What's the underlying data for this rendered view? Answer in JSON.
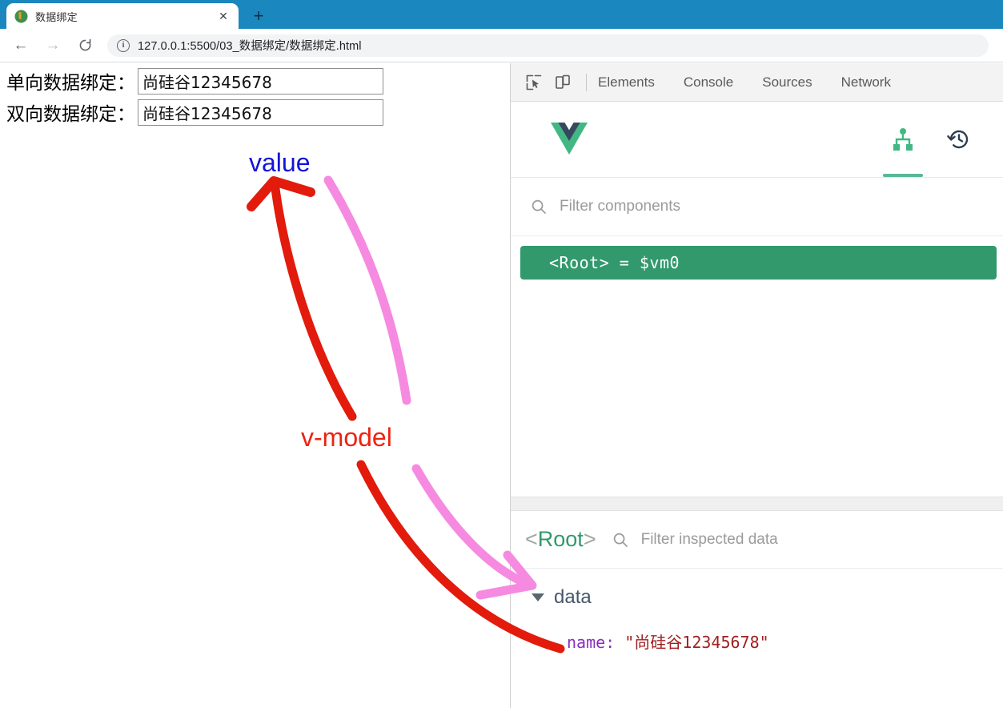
{
  "browser": {
    "tab": {
      "title": "数据绑定",
      "favicon_icon": "vue-circle-favicon",
      "close_icon": "close-icon",
      "close_label": "✕"
    },
    "new_tab_label": "+",
    "new_tab_icon": "plus-icon",
    "nav": {
      "back_icon": "arrow-left-icon",
      "back_label": "←",
      "forward_icon": "arrow-right-icon",
      "forward_label": "→",
      "reload_icon": "reload-icon",
      "reload_label": "⟳"
    },
    "omnibox": {
      "info_icon": "info-circle-icon",
      "info_label": "i",
      "url": "127.0.0.1:5500/03_数据绑定/数据绑定.html"
    }
  },
  "page": {
    "rows": [
      {
        "label": "单向数据绑定：",
        "value": "尚硅谷12345678"
      },
      {
        "label": "双向数据绑定：",
        "value": "尚硅谷12345678"
      }
    ]
  },
  "annotations": {
    "value_label": "value",
    "vmodel_label": "v-model",
    "value_color": "#1414d8",
    "vmodel_color": "#ee2211",
    "red_ink_color": "#e21b0c",
    "pink_ink_color": "#f58ae0"
  },
  "devtools": {
    "toolbar": {
      "inspect_icon": "inspect-element-icon",
      "device_icon": "device-toolbar-icon",
      "tabs": [
        {
          "label": "Elements"
        },
        {
          "label": "Console"
        },
        {
          "label": "Sources"
        },
        {
          "label": "Network"
        }
      ]
    },
    "vue_panel": {
      "logo_icon": "vue-logo-icon",
      "components_icon": "component-tree-icon",
      "timeline_icon": "history-clock-icon",
      "accent_color": "#56b894"
    },
    "component_filter": {
      "search_icon": "search-icon",
      "placeholder": "Filter components"
    },
    "tree": {
      "selected_row": "<Root> = $vm0",
      "selected_color": "#31996c"
    },
    "inspector": {
      "root_prefix": "<",
      "root_name": "Root",
      "root_suffix": ">",
      "search_icon": "search-icon",
      "placeholder": "Filter inspected data",
      "sections": [
        {
          "caret_icon": "caret-down-icon",
          "name": "data",
          "props": [
            {
              "name": "name",
              "colon": ":",
              "value": "\"尚硅谷12345678\""
            }
          ]
        }
      ]
    }
  }
}
